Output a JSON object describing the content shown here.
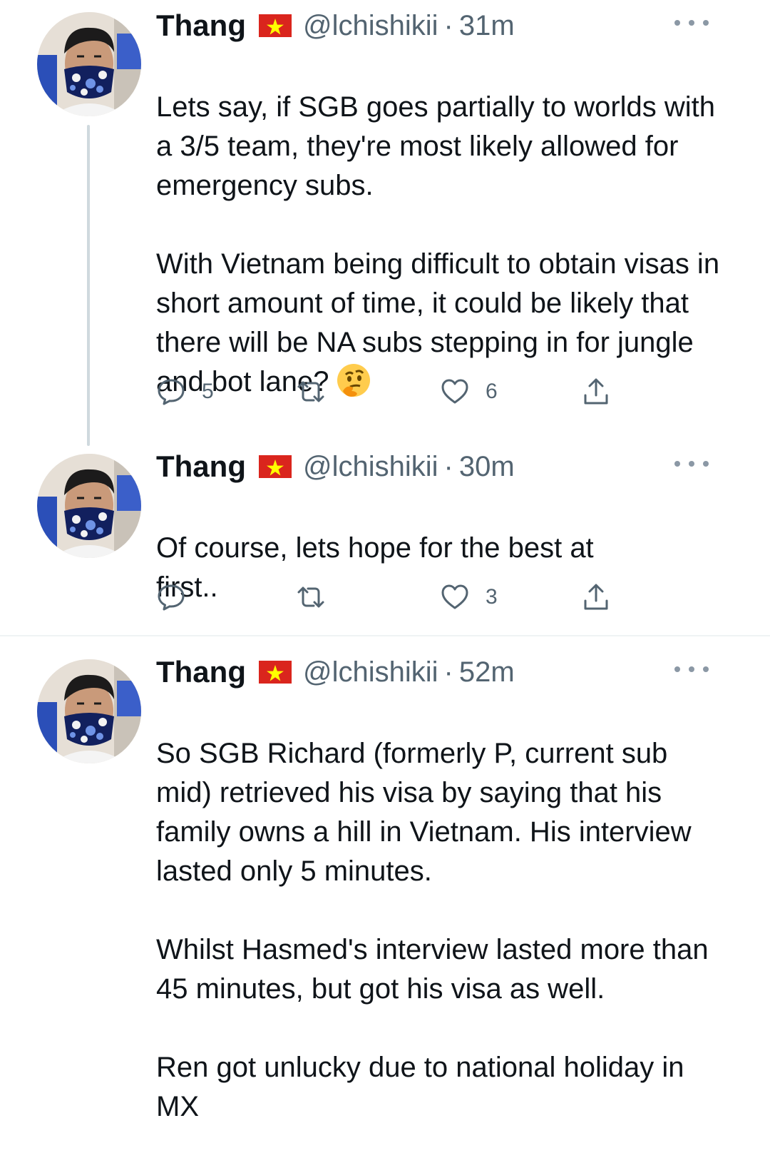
{
  "tweets": [
    {
      "name": "Thang",
      "flag": "vietnam-flag",
      "handle": "@lchishikii",
      "separator": "·",
      "time": "31m",
      "paragraphs": [
        "Lets say, if SGB goes partially to worlds with a 3/5 team, they're most likely allowed for emergency subs.",
        "With Vietnam being difficult to obtain visas in short amount of time, it could be likely that there will be NA subs stepping in for jungle and bot lane?"
      ],
      "emoji": "thinking-face-emoji",
      "replies": "5",
      "retweets": "",
      "likes": "6"
    },
    {
      "name": "Thang",
      "flag": "vietnam-flag",
      "handle": "@lchishikii",
      "separator": "·",
      "time": "30m",
      "paragraphs": [
        "Of course, lets hope for the best at first.."
      ],
      "replies": "",
      "retweets": "",
      "likes": "3"
    },
    {
      "name": "Thang",
      "flag": "vietnam-flag",
      "handle": "@lchishikii",
      "separator": "·",
      "time": "52m",
      "paragraphs": [
        "So SGB Richard (formerly P, current sub mid) retrieved his visa by saying that his family owns a hill in Vietnam. His interview lasted only 5 minutes.",
        "Whilst Hasmed's interview lasted more than 45 minutes, but got his visa as well.",
        "Ren got unlucky due to national holiday in MX"
      ]
    }
  ],
  "colors": {
    "text": "#0f1419",
    "secondary": "#536471",
    "thread_line": "#cfd9de",
    "flag_red": "#da251d",
    "flag_star": "#ffff00"
  }
}
